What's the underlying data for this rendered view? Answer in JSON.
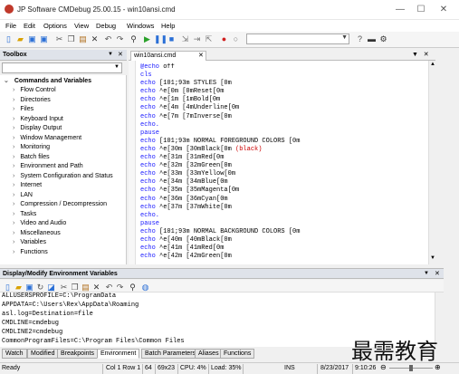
{
  "window": {
    "title": "JP Software CMDebug 25.00.15 - win10ansi.cmd",
    "minimize": "—",
    "maximize": "☐",
    "close": "✕"
  },
  "menu": [
    "File",
    "Edit",
    "Options",
    "View",
    "Debug",
    "Windows",
    "Help"
  ],
  "toolbox": {
    "title": "Toolbox",
    "root": "Commands and Variables",
    "items": [
      "Flow Control",
      "Directories",
      "Files",
      "Keyboard Input",
      "Display Output",
      "Window Management",
      "Monitoring",
      "Batch files",
      "Environment and Path",
      "System Configuration and Status",
      "Internet",
      "LAN",
      "Compression / Decompression",
      "Tasks",
      "Video and Audio",
      "Miscellaneous",
      "Variables",
      "Functions"
    ]
  },
  "editor": {
    "tab": "win10ansi.cmd",
    "lines": [
      [
        "@echo off",
        ""
      ],
      [
        "cls",
        ""
      ],
      [
        "echo [101;93m STYLES [0m",
        ""
      ],
      [
        "echo ^e[0m [0mReset[0m",
        ""
      ],
      [
        "echo ^e[1m [1mBold[0m",
        ""
      ],
      [
        "echo ^e[4m [4mUnderline[0m",
        ""
      ],
      [
        "echo ^e[7m [7mInverse[0m",
        ""
      ],
      [
        "echo.",
        ""
      ],
      [
        "pause",
        ""
      ],
      [
        "echo [101;93m NORMAL FOREGROUND COLORS [0m",
        ""
      ],
      [
        "echo ^e[30m [30mBlack[0m ",
        "(black)"
      ],
      [
        "echo ^e[31m [31mRed[0m",
        ""
      ],
      [
        "echo ^e[32m [32mGreen[0m",
        ""
      ],
      [
        "echo ^e[33m [33mYellow[0m",
        ""
      ],
      [
        "echo ^e[34m [34mBlue[0m",
        ""
      ],
      [
        "echo ^e[35m [35mMagenta[0m",
        ""
      ],
      [
        "echo ^e[36m [36mCyan[0m",
        ""
      ],
      [
        "echo ^e[37m [37mWhite[0m",
        ""
      ],
      [
        "echo.",
        ""
      ],
      [
        "pause",
        ""
      ],
      [
        "echo [101;93m NORMAL BACKGROUND COLORS [0m",
        ""
      ],
      [
        "echo ^e[40m [40mBlack[0m",
        ""
      ],
      [
        "echo ^e[41m [41mRed[0m",
        ""
      ],
      [
        "echo ^e[42m [42mGreen[0m",
        ""
      ]
    ]
  },
  "env": {
    "title": "Display/Modify Environment Variables",
    "rows": [
      "ALLUSERSPROFILE=C:\\ProgramData",
      "APPDATA=C:\\Users\\Rex\\AppData\\Roaming",
      "asl.log=Destination=file",
      "CMDLINE=cmdebug",
      "CMDLINE2=cmdebug",
      "CommonProgramFiles=C:\\Program Files\\Common Files"
    ]
  },
  "bottom_tabs": [
    "Watch",
    "Modified",
    "Breakpoints",
    "Environment",
    "Batch Parameters",
    "Aliases",
    "Functions"
  ],
  "status": {
    "ready": "Ready",
    "pos": "Col 1 Row 1",
    "num": "64",
    "size": "69x23",
    "cpu": "CPU: 4%",
    "load": "Load: 35%",
    "ins": "INS",
    "date": "8/23/2017",
    "time": "9:10:26"
  },
  "watermark": "最需教育",
  "colors": {
    "keyword": "#1a1aff",
    "accent_red": "#cc0000"
  }
}
